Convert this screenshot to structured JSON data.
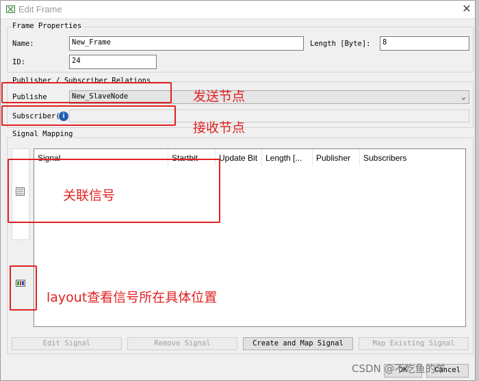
{
  "window": {
    "title": "Edit Frame",
    "close_glyph": "✕"
  },
  "frame_props": {
    "group_label": "Frame Properties",
    "name_label": "Name:",
    "name_value": "New_Frame",
    "length_label": "Length [Byte]:",
    "length_value": "8",
    "id_label": "ID:",
    "id_value": "24"
  },
  "relations": {
    "group_label": "Publisher / Subscriber Relations",
    "publisher_label": "Publishe",
    "publisher_value": "New_SlaveNode",
    "subscriber_label": "Subscriber(",
    "info_glyph": "i"
  },
  "signal_mapping": {
    "group_label": "Signal Mapping",
    "columns": [
      "Signal",
      "Startbit",
      "Update Bit",
      "Length [...",
      "Publisher",
      "Subscribers"
    ]
  },
  "buttons": {
    "edit_signal": "Edit Signal",
    "remove_signal": "Remove Signal",
    "create_map_signal": "Create and Map Signal",
    "map_existing_signal": "Map Existing Signal",
    "ok": "OK",
    "cancel": "Cancel"
  },
  "annotations": {
    "publish": "发送节点",
    "subscribe": "接收节点",
    "signals": "关联信号",
    "layout": "layout查看信号所在具体位置",
    "color": "#e02020"
  },
  "watermark": "CSDN @不吃鱼的羊"
}
